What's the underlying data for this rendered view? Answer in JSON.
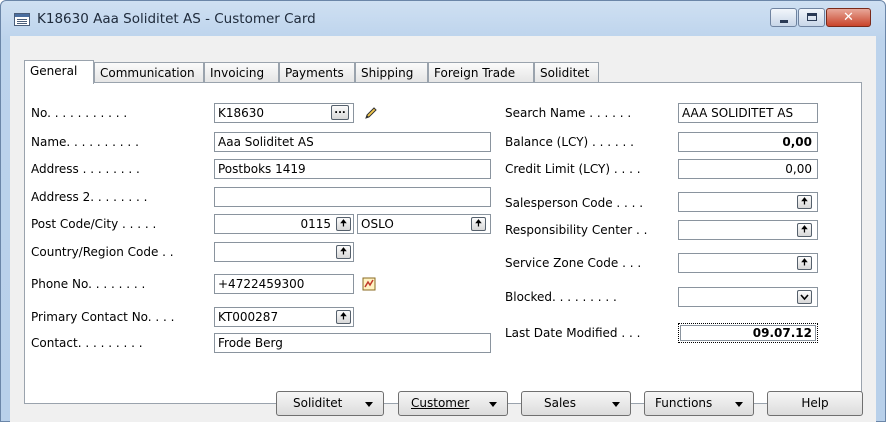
{
  "window": {
    "title": "K18630 Aaa Soliditet AS - Customer Card",
    "controls": {
      "minimize": "minimize-icon",
      "maximize": "maximize-icon",
      "close": "close-icon"
    }
  },
  "tabs": [
    {
      "label": "General",
      "active": true
    },
    {
      "label": "Communication"
    },
    {
      "label": "Invoicing"
    },
    {
      "label": "Payments"
    },
    {
      "label": "Shipping"
    },
    {
      "label": "Foreign Trade"
    },
    {
      "label": "Soliditet"
    }
  ],
  "left_fields": {
    "no": {
      "label": "No. . . . . . . . . . .",
      "value": "K18630"
    },
    "name": {
      "label": "Name. . . . . . . . . .",
      "value": "Aaa Soliditet AS"
    },
    "address": {
      "label": "Address  . . . . . . . .",
      "value": "Postboks 1419"
    },
    "address2": {
      "label": "Address 2. . . . . . . .",
      "value": ""
    },
    "post_code_city": {
      "label": "Post Code/City  . . . . .",
      "post_code": "0115",
      "city": "OSLO"
    },
    "country": {
      "label": "Country/Region Code . .",
      "value": ""
    },
    "phone": {
      "label": "Phone No. . . . . . . .",
      "value": "+4722459300"
    },
    "primary_contact": {
      "label": "Primary Contact No. . . .",
      "value": "KT000287"
    },
    "contact": {
      "label": "Contact. . . . . . . . .",
      "value": "Frode Berg"
    }
  },
  "right_fields": {
    "search_name": {
      "label": "Search Name . . . . . .",
      "value": "AAA SOLIDITET AS"
    },
    "balance": {
      "label": "Balance (LCY) . . . . . .",
      "value": "0,00"
    },
    "credit_limit": {
      "label": "Credit Limit (LCY)  . . . .",
      "value": "0,00"
    },
    "salesperson": {
      "label": "Salesperson Code . . . .",
      "value": ""
    },
    "responsibility": {
      "label": "Responsibility Center  . .",
      "value": ""
    },
    "service_zone": {
      "label": "Service Zone Code  . . .",
      "value": ""
    },
    "blocked": {
      "label": "Blocked. . . . . . . . .",
      "value": ""
    },
    "last_modified": {
      "label": "Last Date Modified  . . .",
      "value": "09.07.12"
    }
  },
  "buttons": {
    "soliditet": "Soliditet",
    "customer": "Customer",
    "sales": "Sales",
    "functions": "Functions",
    "help": "Help"
  },
  "glyphs": {
    "assist": "...",
    "lookup": "🠉"
  },
  "colors": {
    "title_gradient_top": "#cfe0f2",
    "title_gradient_bottom": "#b8d0ea",
    "close_button": "#c9442a"
  }
}
